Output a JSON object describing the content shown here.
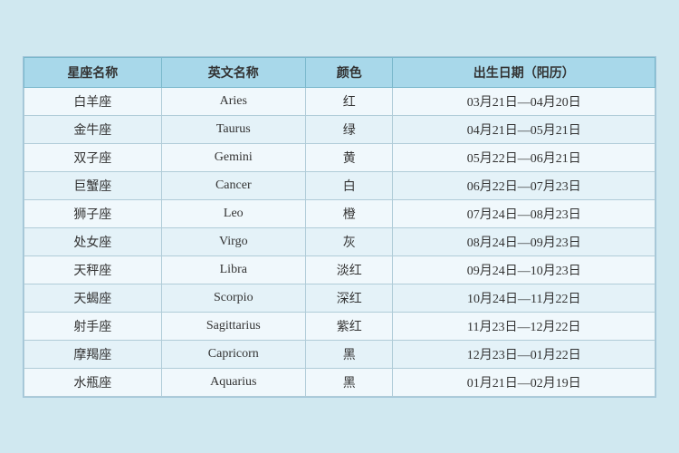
{
  "table": {
    "headers": [
      "星座名称",
      "英文名称",
      "颜色",
      "出生日期（阳历）"
    ],
    "rows": [
      {
        "chinese": "白羊座",
        "english": "Aries",
        "color": "红",
        "dates": "03月21日—04月20日"
      },
      {
        "chinese": "金牛座",
        "english": "Taurus",
        "color": "绿",
        "dates": "04月21日—05月21日"
      },
      {
        "chinese": "双子座",
        "english": "Gemini",
        "color": "黄",
        "dates": "05月22日—06月21日"
      },
      {
        "chinese": "巨蟹座",
        "english": "Cancer",
        "color": "白",
        "dates": "06月22日—07月23日"
      },
      {
        "chinese": "狮子座",
        "english": "Leo",
        "color": "橙",
        "dates": "07月24日—08月23日"
      },
      {
        "chinese": "处女座",
        "english": "Virgo",
        "color": "灰",
        "dates": "08月24日—09月23日"
      },
      {
        "chinese": "天秤座",
        "english": "Libra",
        "color": "淡红",
        "dates": "09月24日—10月23日"
      },
      {
        "chinese": "天蝎座",
        "english": "Scorpio",
        "color": "深红",
        "dates": "10月24日—11月22日"
      },
      {
        "chinese": "射手座",
        "english": "Sagittarius",
        "color": "紫红",
        "dates": "11月23日—12月22日"
      },
      {
        "chinese": "摩羯座",
        "english": "Capricorn",
        "color": "黑",
        "dates": "12月23日—01月22日"
      },
      {
        "chinese": "水瓶座",
        "english": "Aquarius",
        "color": "黑",
        "dates": "01月21日—02月19日"
      }
    ]
  }
}
